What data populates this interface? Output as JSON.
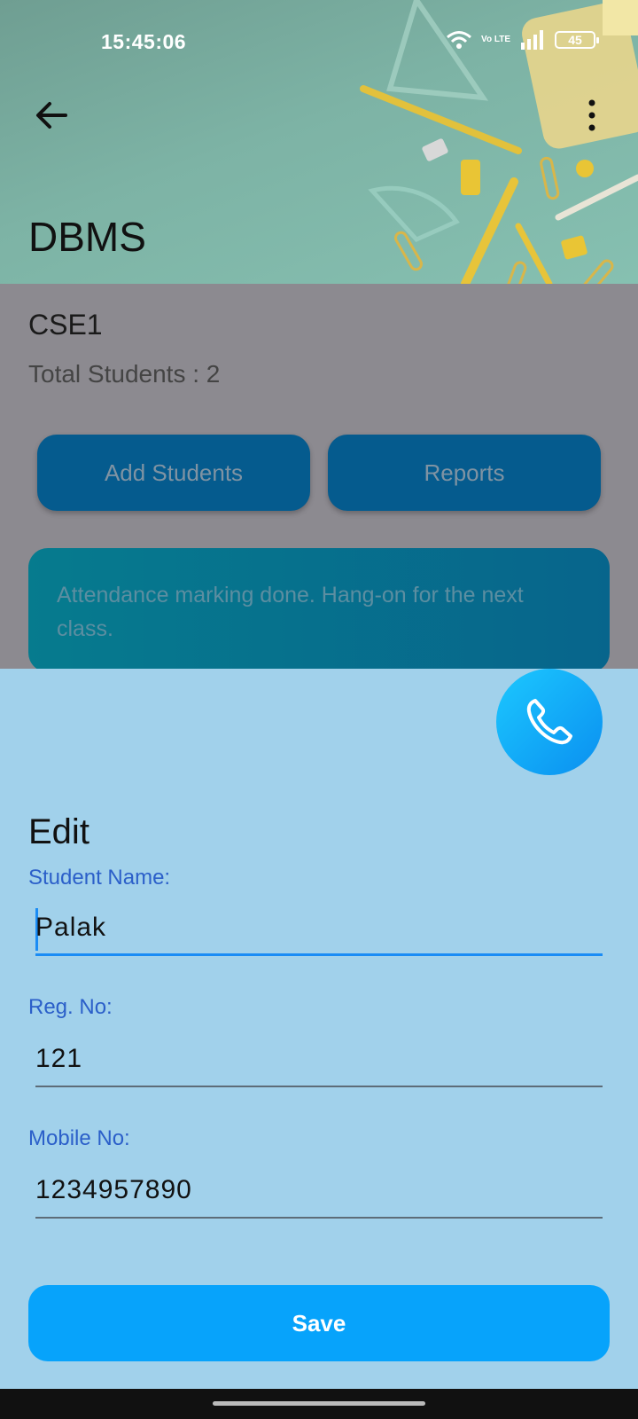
{
  "status_bar": {
    "time": "15:45:06",
    "battery": "45",
    "network_label": "Vo LTE",
    "icons": [
      "wifi-icon",
      "volte-icon",
      "signal-icon",
      "battery-icon"
    ]
  },
  "header": {
    "title": "DBMS",
    "back_icon": "arrow-left-icon",
    "menu_icon": "more-vertical-icon"
  },
  "class_info": {
    "name": "CSE1",
    "total_students": "Total Students : 2"
  },
  "buttons": {
    "add_students": "Add Students",
    "reports": "Reports"
  },
  "banner": {
    "message": "Attendance marking done. Hang-on for the next class."
  },
  "edit_sheet": {
    "call_icon": "phone-icon",
    "title": "Edit",
    "student_name_label": "Student Name:",
    "student_name_value": "Palak",
    "reg_no_label": "Reg. No:",
    "reg_no_value": "121",
    "mobile_label": "Mobile No:",
    "mobile_value": "1234957890",
    "save_label": "Save"
  },
  "colors": {
    "accent": "#07a3fb",
    "sheet_bg": "#a1d1eb",
    "label": "#2b5fc9",
    "dim_button": "#055b8e"
  }
}
